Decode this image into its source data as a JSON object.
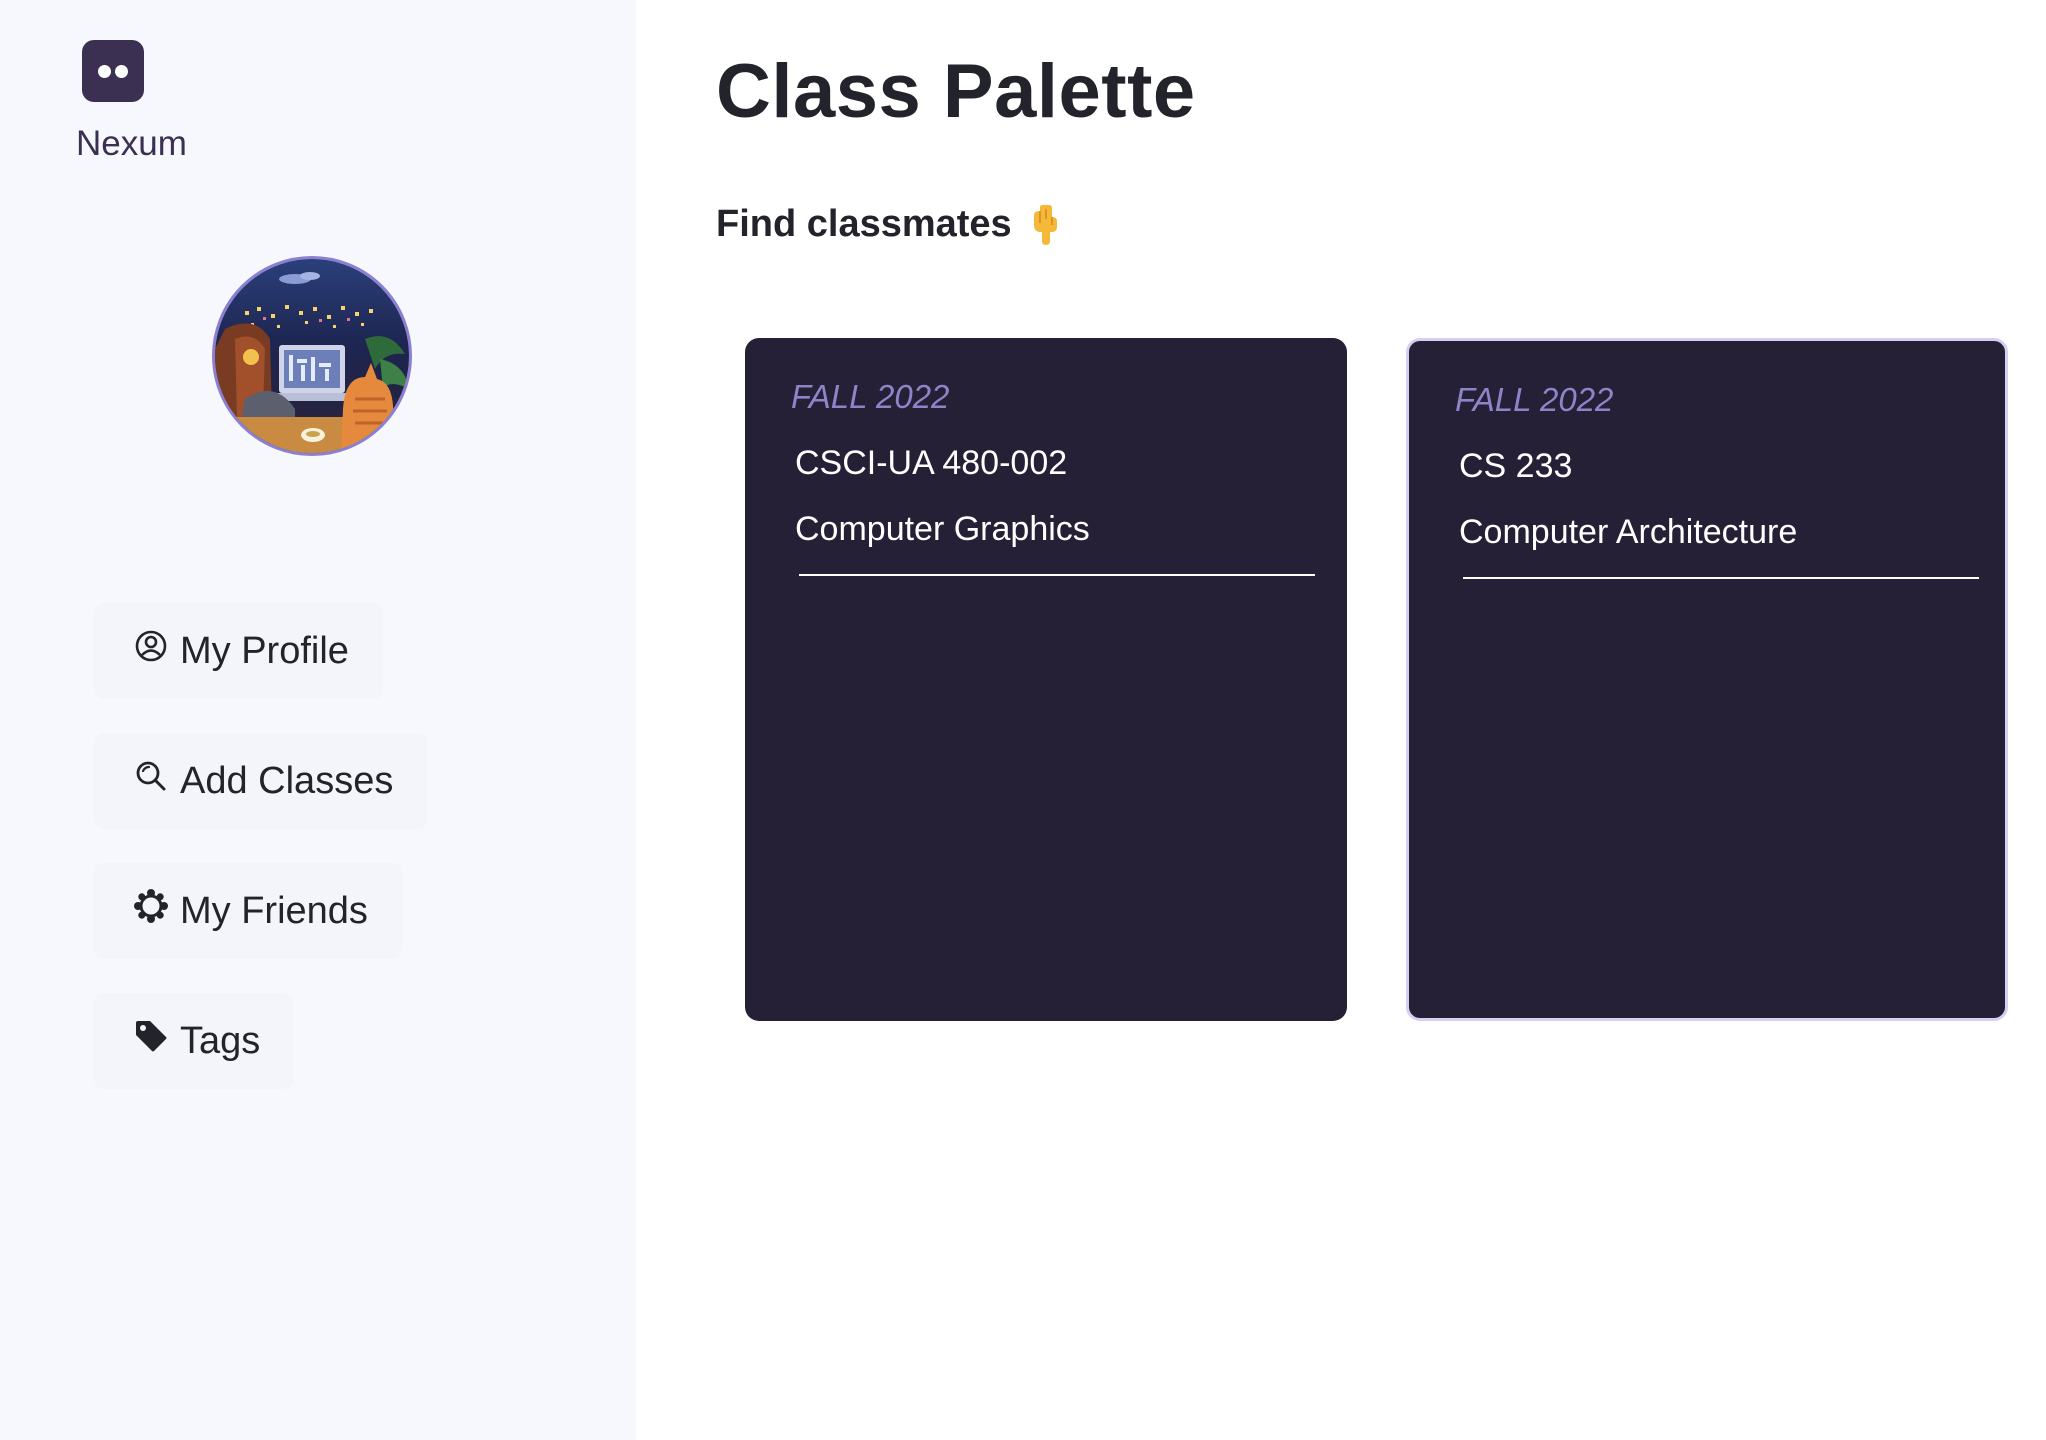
{
  "brand": {
    "name": "Nexum",
    "icon": "robot-face-icon",
    "color": "#3b3052"
  },
  "sidebar": {
    "avatar_alt": "profile-avatar",
    "nav": [
      {
        "label": "My Profile",
        "icon": "user-circle-icon"
      },
      {
        "label": "Add Classes",
        "icon": "search-icon"
      },
      {
        "label": "My Friends",
        "icon": "friends-ring-icon"
      },
      {
        "label": "Tags",
        "icon": "tag-icon"
      }
    ]
  },
  "main": {
    "title": "Class Palette",
    "subtitle": "Find classmates",
    "subtitle_emoji": "👇",
    "cards": [
      {
        "term": "FALL 2022",
        "code": "CSCI-UA 480-002",
        "name": "Computer Graphics"
      },
      {
        "term": "FALL 2022",
        "code": "CS 233",
        "name": "Computer Architecture"
      }
    ]
  },
  "colors": {
    "sidebar_bg": "#f7f8fd",
    "card_bg": "#252036",
    "term_text": "#8e84c8",
    "card_highlight_border": "#d6cff4"
  }
}
